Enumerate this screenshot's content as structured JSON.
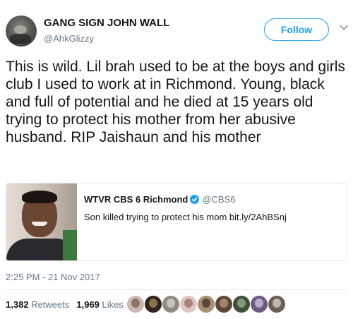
{
  "author": {
    "display_name": "GANG SIGN JOHN WALL",
    "handle": "@AhkGlizzy",
    "follow_label": "Follow"
  },
  "tweet": {
    "text": "This is wild. Lil brah used to be at the boys and girls club I used to work at in Richmond. Young, black and full of potential and he died at 15 years old trying to protect his mother from her abusive husband. RIP Jaishaun and his mother",
    "timestamp": "2:25 PM - 21 Nov 2017"
  },
  "quoted_tweet": {
    "display_name": "WTVR CBS 6 Richmond",
    "handle": "@CBS6",
    "text": "Son killed trying to protect his mom bit.ly/2AhBSnj",
    "verified": true
  },
  "stats": {
    "retweets_count": "1,382",
    "retweets_label": "Retweets",
    "likes_count": "1,969",
    "likes_label": "Likes"
  },
  "likers": [
    {
      "bg": "#c9b8b0",
      "fg": "#7a5a4e",
      "icon": "avatar"
    },
    {
      "bg": "#2b2420",
      "fg": "#b08a62",
      "icon": "avatar"
    },
    {
      "bg": "#8f8a83",
      "fg": "#d9d4cc",
      "icon": "avatar"
    },
    {
      "bg": "#e0c6c2",
      "fg": "#9a6a60",
      "icon": "avatar"
    },
    {
      "bg": "#a89072",
      "fg": "#3d3228",
      "icon": "avatar"
    },
    {
      "bg": "#5b463b",
      "fg": "#c09a78",
      "icon": "avatar"
    },
    {
      "bg": "#3f4f3a",
      "fg": "#9fb08a",
      "icon": "avatar"
    },
    {
      "bg": "#6d5a86",
      "fg": "#d2c7e0",
      "icon": "avatar"
    },
    {
      "bg": "#6a5e55",
      "fg": "#e3d5c7",
      "icon": "avatar"
    }
  ],
  "colors": {
    "accent": "#1da1f2",
    "text_primary": "#14171a",
    "text_secondary": "#657786",
    "border": "#e1e8ed"
  }
}
